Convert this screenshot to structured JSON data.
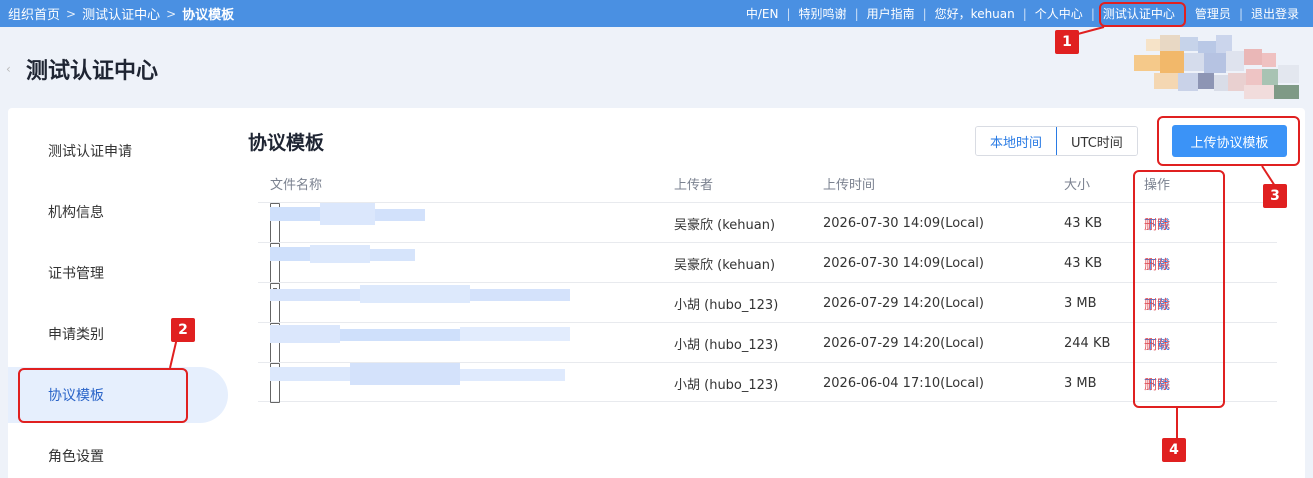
{
  "breadcrumb": {
    "items": [
      "组织首页",
      "测试认证中心",
      "协议模板"
    ],
    "separator": ">"
  },
  "topnav": [
    "中/EN",
    "特别鸣谢",
    "用户指南",
    "您好，kehuan",
    "个人中心",
    "测试认证中心",
    "管理员",
    "退出登录"
  ],
  "header": {
    "title": "测试认证中心"
  },
  "sidebar": {
    "items": [
      {
        "label": "测试认证申请"
      },
      {
        "label": "机构信息"
      },
      {
        "label": "证书管理"
      },
      {
        "label": "申请类别"
      },
      {
        "label": "协议模板",
        "active": true
      },
      {
        "label": "角色设置"
      }
    ]
  },
  "main": {
    "title": "协议模板",
    "tz": {
      "local": "本地时间",
      "utc": "UTC时间",
      "selected": "本地时间"
    },
    "upload_label": "上传协议模板",
    "columns": [
      "文件名称",
      "上传者",
      "上传时间",
      "大小",
      "操作"
    ],
    "rows": [
      {
        "uploader": "吴豪欣 (kehuan)",
        "time": "2026-07-30 14:09(Local)",
        "size": "43 KB",
        "download": "下载",
        "delete": "删除"
      },
      {
        "uploader": "吴豪欣 (kehuan)",
        "time": "2026-07-30 14:09(Local)",
        "size": "43 KB",
        "download": "下载",
        "delete": "删除"
      },
      {
        "uploader": "小胡 (hubo_123)",
        "time": "2026-07-29 14:20(Local)",
        "size": "3 MB",
        "download": "下载",
        "delete": "删除"
      },
      {
        "uploader": "小胡 (hubo_123)",
        "time": "2026-07-29 14:20(Local)",
        "size": "244 KB",
        "download": "下载",
        "delete": "删除"
      },
      {
        "uploader": "小胡 (hubo_123)",
        "time": "2026-06-04 17:10(Local)",
        "size": "3 MB",
        "download": "下载",
        "delete": "删除"
      }
    ]
  },
  "annotations": [
    "1",
    "2",
    "3",
    "4"
  ],
  "colors": {
    "topbar": "#4a90e2",
    "accent": "#3b93f7",
    "link": "#2a7be4",
    "danger": "#e0525a",
    "annotation": "#e02020"
  }
}
